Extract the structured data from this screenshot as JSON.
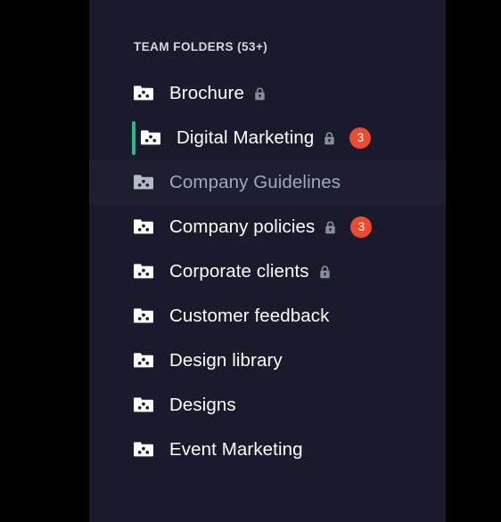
{
  "panel": {
    "header": "TEAM FOLDERS (53+)",
    "accent_color": "#2BB98C",
    "badge_color": "#F04A2E",
    "background_color": "#191A2B",
    "page_background": "#000000",
    "folder_icon_name": "shared-folder-icon",
    "lock_icon_name": "lock-icon",
    "items": [
      {
        "label": "Brochure",
        "locked": true,
        "badge": "",
        "selected": false,
        "hovered": false
      },
      {
        "label": "Digital Marketing",
        "locked": true,
        "badge": "3",
        "selected": true,
        "hovered": false
      },
      {
        "label": "Company Guidelines",
        "locked": false,
        "badge": "",
        "selected": false,
        "hovered": true
      },
      {
        "label": "Company policies",
        "locked": true,
        "badge": "3",
        "selected": false,
        "hovered": false
      },
      {
        "label": "Corporate clients",
        "locked": true,
        "badge": "",
        "selected": false,
        "hovered": false
      },
      {
        "label": "Customer feedback",
        "locked": false,
        "badge": "",
        "selected": false,
        "hovered": false
      },
      {
        "label": "Design library",
        "locked": false,
        "badge": "",
        "selected": false,
        "hovered": false
      },
      {
        "label": "Designs",
        "locked": false,
        "badge": "",
        "selected": false,
        "hovered": false
      },
      {
        "label": "Event Marketing",
        "locked": false,
        "badge": "",
        "selected": false,
        "hovered": false
      }
    ]
  }
}
